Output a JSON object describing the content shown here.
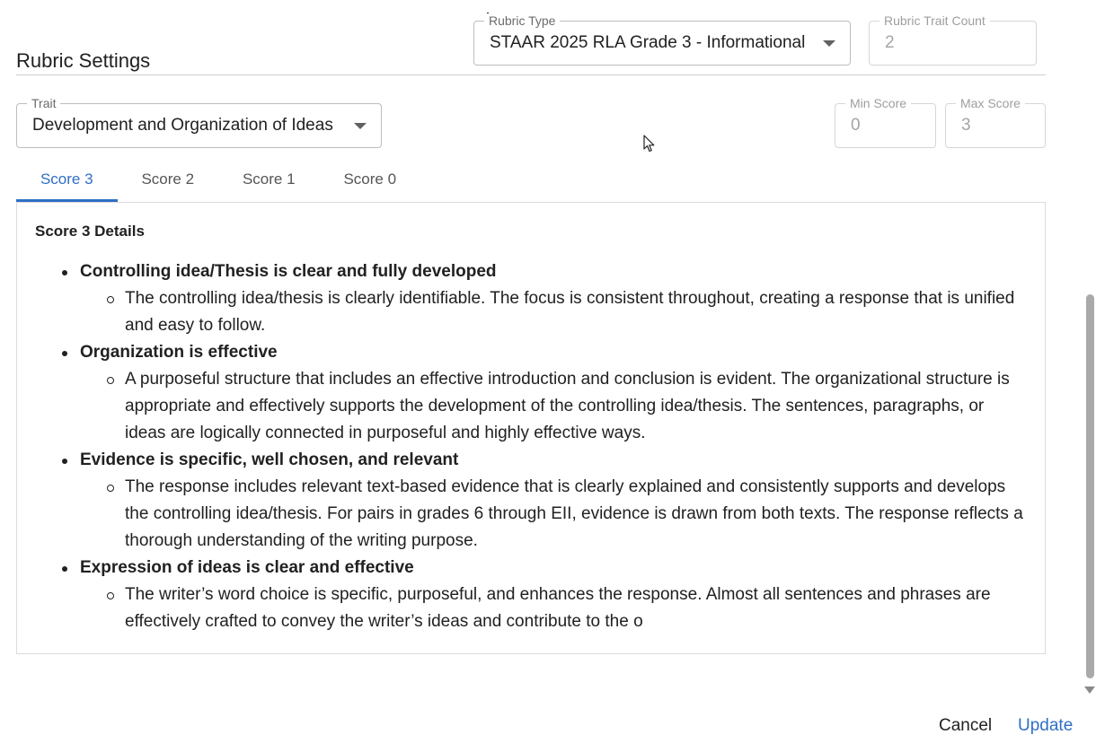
{
  "settings": {
    "title": "Rubric Settings",
    "rubric_type_label": "Rubric Type",
    "rubric_type_value": "STAAR 2025 RLA Grade 3 - Informational",
    "trait_count_label": "Rubric Trait Count",
    "trait_count_value": "2",
    "trait_label": "Trait",
    "trait_value": "Development and Organization of Ideas",
    "min_score_label": "Min Score",
    "min_score_value": "0",
    "max_score_label": "Max Score",
    "max_score_value": "3"
  },
  "tabs": [
    {
      "label": "Score 3",
      "active": true
    },
    {
      "label": "Score 2",
      "active": false
    },
    {
      "label": "Score 1",
      "active": false
    },
    {
      "label": "Score 0",
      "active": false
    }
  ],
  "details": {
    "title": "Score 3 Details",
    "items": [
      {
        "heading": "Controlling idea/Thesis is clear and fully developed",
        "text": "The controlling idea/thesis is clearly identifiable. The focus is consistent throughout, creating a response that is unified and easy to follow."
      },
      {
        "heading": "Organization is effective",
        "text": "A purposeful structure that includes an effective introduction and conclusion is evident. The organizational structure is appropriate and effectively supports the development of the controlling idea/thesis. The sentences, paragraphs, or ideas are logically connected in purposeful and highly effective ways."
      },
      {
        "heading": "Evidence is specific, well chosen, and relevant",
        "text": "The response includes relevant text-based evidence that is clearly explained and consistently supports and develops the controlling idea/thesis. For pairs in grades 6 through EII, evidence is drawn from both texts. The response reflects a thorough understanding of the writing purpose."
      },
      {
        "heading": "Expression of ideas is clear and effective",
        "text": "The writer’s word choice is specific, purposeful, and enhances the response. Almost all sentences and phrases are effectively crafted to convey the writer’s ideas and contribute to the o"
      }
    ]
  },
  "actions": {
    "cancel_label": "Cancel",
    "update_label": "Update"
  },
  "colors": {
    "accent": "#2f6fc5",
    "text": "#212121",
    "border": "#bdbdbd"
  }
}
